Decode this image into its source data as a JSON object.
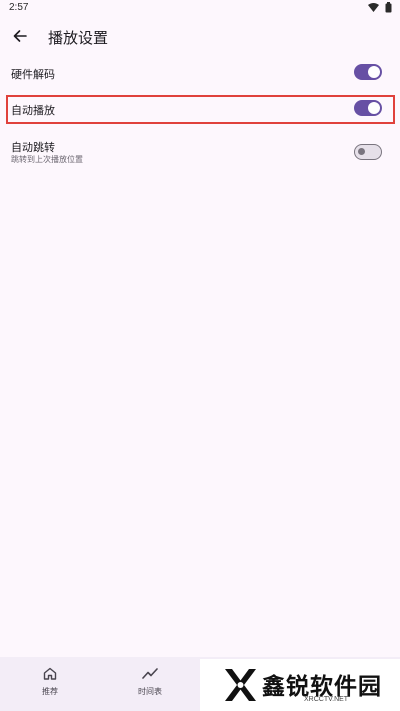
{
  "status_bar": {
    "time": "2:57",
    "icons": [
      "wifi-icon",
      "battery-icon"
    ]
  },
  "app_bar": {
    "title": "播放设置",
    "back_icon": "arrow-back-icon"
  },
  "settings": [
    {
      "label": "硬件解码",
      "enabled": true
    },
    {
      "label": "自动播放",
      "enabled": true
    },
    {
      "label": "自动跳转",
      "subtitle": "跳转到上次播放位置",
      "enabled": false
    }
  ],
  "colors": {
    "accent": "#6750a4",
    "background": "#fdf7fd",
    "highlight": "#e0413c",
    "nav_background": "#f3edf7"
  },
  "bottom_nav": {
    "items": [
      {
        "label": "推荐",
        "icon": "home-icon"
      },
      {
        "label": "时间表",
        "icon": "trending-icon"
      }
    ]
  },
  "watermark": {
    "text": "鑫锐软件园",
    "url": "XRCCTV.NET"
  }
}
